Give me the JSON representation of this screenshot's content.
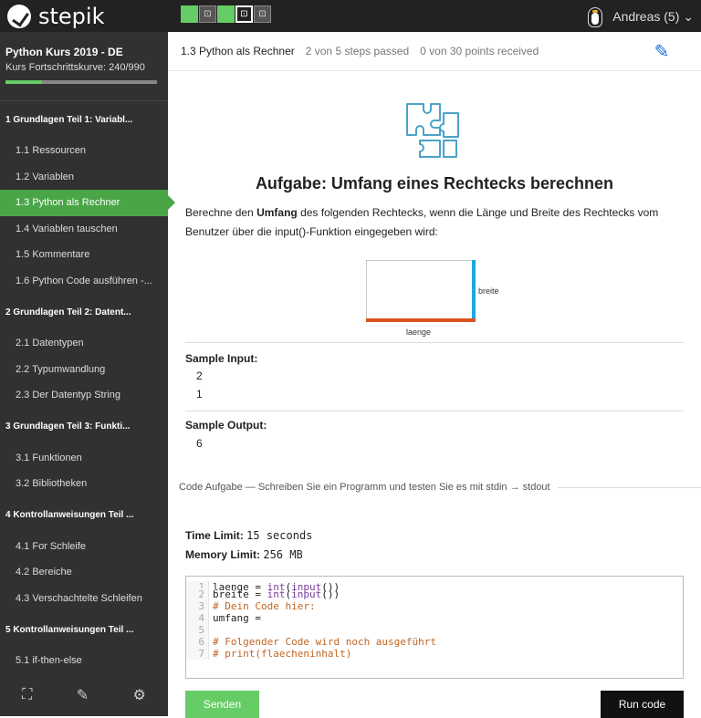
{
  "topbar": {
    "brand": "stepik",
    "user_label": "Andreas (5) ⌄",
    "step_icons": [
      "done",
      "code",
      "done",
      "code",
      "code"
    ]
  },
  "course": {
    "title": "Python Kurs 2019 - DE",
    "progress_label": "Kurs Fortschrittskurve:",
    "progress_value": "240/990",
    "progress_fraction": 0.242
  },
  "sidebar": {
    "sections": [
      {
        "label": "1  Grundlagen Teil 1: Variabl...",
        "items": [
          "1.1  Ressourcen",
          "1.2  Variablen",
          "1.3  Python als Rechner",
          "1.4  Variablen tauschen",
          "1.5  Kommentare",
          "1.6  Python Code ausführen -..."
        ]
      },
      {
        "label": "2  Grundlagen Teil 2: Datent...",
        "items": [
          "2.1  Datentypen",
          "2.2  Typumwandlung",
          "2.3  Der Datentyp String"
        ]
      },
      {
        "label": "3  Grundlagen Teil 3: Funkti...",
        "items": [
          "3.1  Funktionen",
          "3.2  Bibliotheken"
        ]
      },
      {
        "label": "4  Kontrollanweisungen Teil ...",
        "items": [
          "4.1  For Schleife",
          "4.2  Bereiche",
          "4.3  Verschachtelte Schleifen"
        ]
      },
      {
        "label": "5  Kontrollanweisungen Teil ...",
        "items": [
          "5.1  if-then-else"
        ]
      }
    ],
    "active_item": "1.3  Python als Rechner",
    "footer_icons": [
      "fullscreen-icon",
      "pencil-icon",
      "gear-icon"
    ]
  },
  "header": {
    "step_title": "1.3 Python als Rechner",
    "steps_passed": "2 von 5 steps passed",
    "points": "0 von 30 points  received"
  },
  "task": {
    "title": "Aufgabe: Umfang eines Rechtecks berechnen",
    "desc_pre": "Berechne den ",
    "desc_bold": "Umfang",
    "desc_post": " des folgenden Rechtecks, wenn die Länge und Breite des Rechtecks vom Benutzer über die input()-Funktion eingegeben wird:",
    "diagram": {
      "label_width": "breite",
      "label_length": "laenge"
    },
    "sample_input_label": "Sample Input:",
    "sample_input": [
      "2",
      "1"
    ],
    "sample_output_label": "Sample Output:",
    "sample_output": [
      "6"
    ]
  },
  "code_task": {
    "heading": "Code Aufgabe — Schreiben Sie ein Programm und testen Sie es mit stdin → stdout",
    "time_label": "Time Limit:",
    "time_value": "15 seconds",
    "memory_label": "Memory Limit:",
    "memory_value": "256 MB",
    "lines": [
      {
        "n": "1",
        "segments": [
          [
            "",
            "laenge = "
          ],
          [
            "kw",
            "int"
          ],
          [
            "",
            "("
          ],
          [
            "kw",
            "input"
          ],
          [
            "",
            "())"
          ]
        ]
      },
      {
        "n": "2",
        "segments": [
          [
            "",
            "breite = "
          ],
          [
            "kw",
            "int"
          ],
          [
            "",
            "("
          ],
          [
            "kw",
            "input"
          ],
          [
            "",
            "())"
          ]
        ]
      },
      {
        "n": "3",
        "segments": [
          [
            "cm",
            "# Dein Code hier:"
          ]
        ]
      },
      {
        "n": "4",
        "segments": [
          [
            "",
            "umfang = "
          ]
        ]
      },
      {
        "n": "5",
        "segments": [
          [
            "",
            ""
          ]
        ]
      },
      {
        "n": "6",
        "segments": [
          [
            "cm",
            "# Folgender Code wird noch ausgeführt"
          ]
        ]
      },
      {
        "n": "7",
        "segments": [
          [
            "cm",
            "# print(flaecheninhalt)"
          ]
        ]
      }
    ],
    "send_label": "Senden",
    "run_label": "Run code"
  },
  "colors": {
    "accent_green": "#66cc66",
    "active_green": "#4aa547",
    "dark": "#313131",
    "edit_blue": "#1e6fd9",
    "diagram_blue": "#1ea7e1",
    "diagram_orange": "#d9531e"
  }
}
